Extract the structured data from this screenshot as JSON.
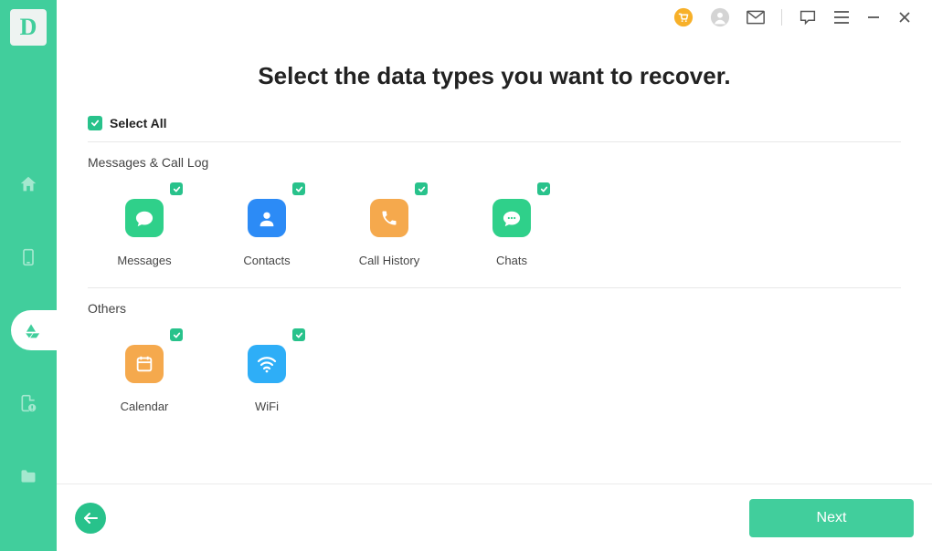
{
  "app": {
    "logo_letter": "D"
  },
  "header": {
    "title": "Select the data types you want to recover.",
    "select_all_label": "Select All"
  },
  "sections": {
    "messages_call_log": {
      "title": "Messages & Call Log",
      "tiles": {
        "messages": {
          "label": "Messages",
          "checked": true,
          "color": "#2fd08a"
        },
        "contacts": {
          "label": "Contacts",
          "checked": true,
          "color": "#2c8bf6"
        },
        "call_history": {
          "label": "Call History",
          "checked": true,
          "color": "#f5a94d"
        },
        "chats": {
          "label": "Chats",
          "checked": true,
          "color": "#2fd08a"
        }
      }
    },
    "others": {
      "title": "Others",
      "tiles": {
        "calendar": {
          "label": "Calendar",
          "checked": true,
          "color": "#f5a94d"
        },
        "wifi": {
          "label": "WiFi",
          "checked": true,
          "color": "#2eaef7"
        }
      }
    }
  },
  "footer": {
    "next_label": "Next"
  },
  "colors": {
    "accent": "#41ce9c",
    "check": "#28c28b"
  }
}
